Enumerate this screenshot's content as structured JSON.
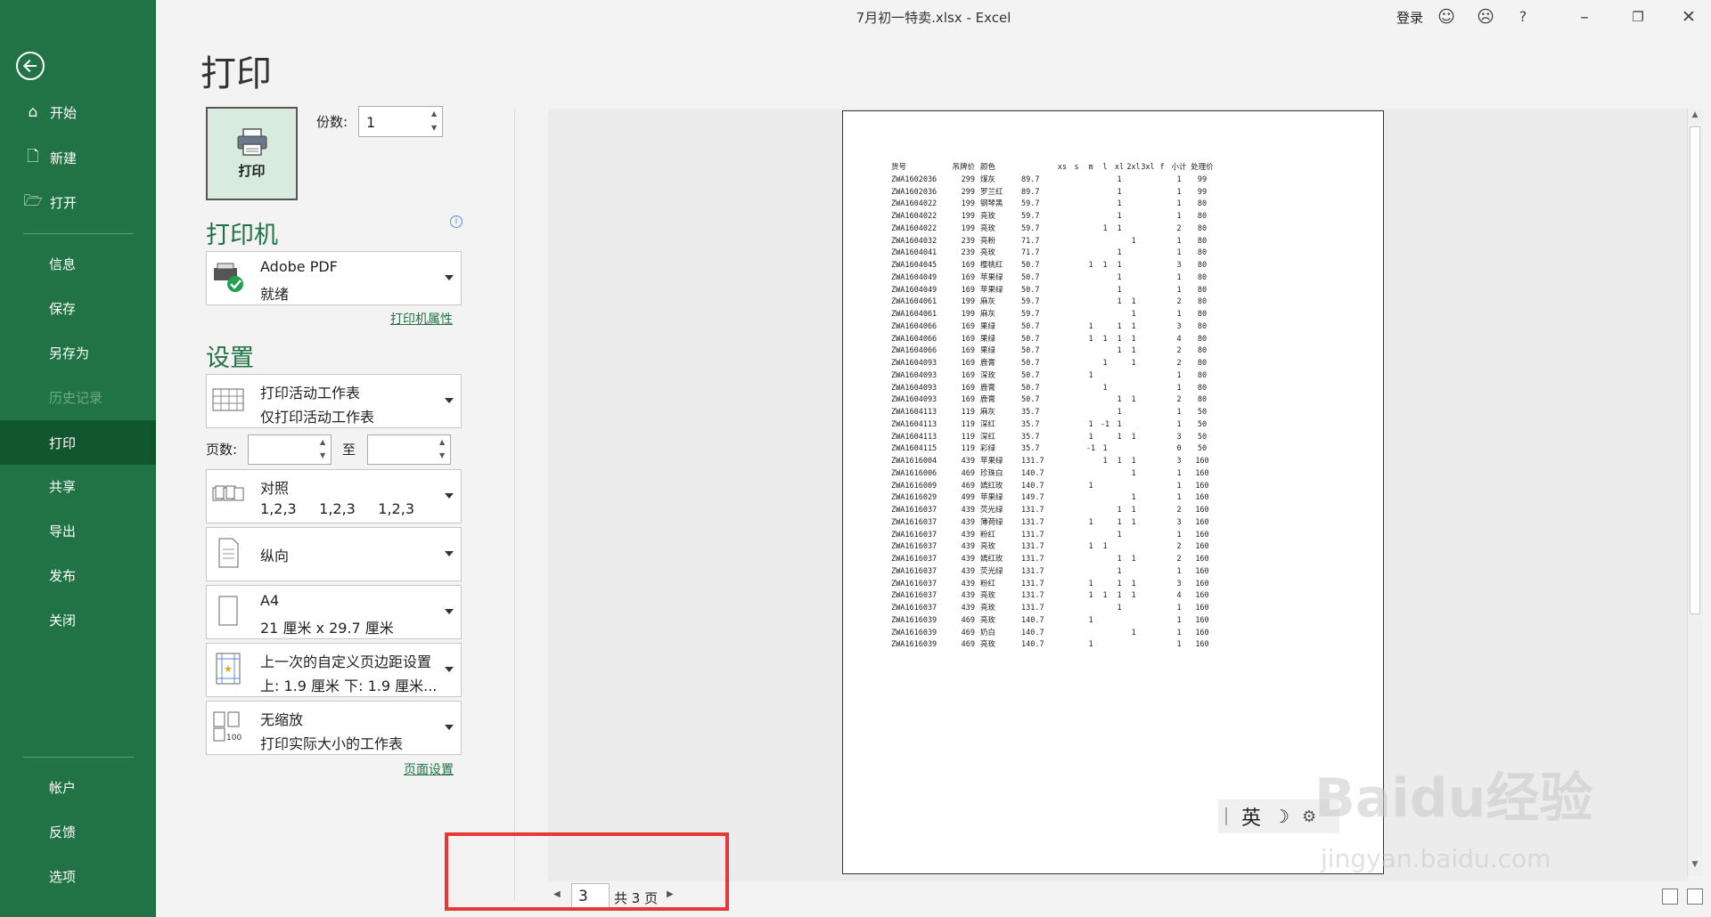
{
  "window": {
    "title": "7月初一特卖.xlsx  -  Excel",
    "signin": "登录"
  },
  "sidebar": {
    "top_items": [
      {
        "label": "开始",
        "icon": "home-icon"
      },
      {
        "label": "新建",
        "icon": "new-doc-icon"
      },
      {
        "label": "打开",
        "icon": "folder-open-icon"
      }
    ],
    "mid_items": [
      "信息",
      "保存",
      "另存为",
      "历史记录",
      "打印",
      "共享",
      "导出",
      "发布",
      "关闭"
    ],
    "active": "打印",
    "disabled": "历史记录",
    "bottom_items": [
      "帐户",
      "反馈",
      "选项"
    ]
  },
  "page_title": "打印",
  "print": {
    "button_label": "打印",
    "copies_label": "份数:",
    "copies_value": "1"
  },
  "printer": {
    "header": "打印机",
    "name": "Adobe PDF",
    "status": "就绪",
    "properties_link": "打印机属性"
  },
  "settings": {
    "header": "设置",
    "what": {
      "line1": "打印活动工作表",
      "line2": "仅打印活动工作表"
    },
    "pages_label": "页数:",
    "to_label": "至",
    "collate": {
      "line1": "对照",
      "line2": "1,2,3     1,2,3     1,2,3"
    },
    "orientation": "纵向",
    "paper": {
      "line1": "A4",
      "line2": "21 厘米 x 29.7 厘米"
    },
    "margins": {
      "line1": "上一次的自定义页边距设置",
      "line2": "上: 1.9 厘米 下: 1.9 厘米..."
    },
    "scaling": {
      "line1": "无缩放",
      "line2": "打印实际大小的工作表"
    },
    "page_setup_link": "页面设置"
  },
  "preview": {
    "headers": [
      "货号",
      "吊牌价",
      "颜色",
      "",
      "xs",
      "s",
      "m",
      "l",
      "xl",
      "2xl",
      "3xl",
      "f",
      "小计",
      "处理价"
    ],
    "rows": [
      [
        "ZWA1602036",
        "299",
        "煤灰",
        "89.7",
        "",
        "",
        "",
        "",
        "1",
        "",
        "",
        "",
        "1",
        "99"
      ],
      [
        "ZWA1602036",
        "299",
        "罗兰红",
        "89.7",
        "",
        "",
        "",
        "",
        "1",
        "",
        "",
        "",
        "1",
        "99"
      ],
      [
        "ZWA1604022",
        "199",
        "钢琴黑",
        "59.7",
        "",
        "",
        "",
        "",
        "1",
        "",
        "",
        "",
        "1",
        "80"
      ],
      [
        "ZWA1604022",
        "199",
        "亮玫",
        "59.7",
        "",
        "",
        "",
        "",
        "1",
        "",
        "",
        "",
        "1",
        "80"
      ],
      [
        "ZWA1604022",
        "199",
        "亮玫",
        "59.7",
        "",
        "",
        "",
        "1",
        "1",
        "",
        "",
        "",
        "2",
        "80"
      ],
      [
        "ZWA1604032",
        "239",
        "亮粉",
        "71.7",
        "",
        "",
        "",
        "",
        "",
        "1",
        "",
        "",
        "1",
        "80"
      ],
      [
        "ZWA1604041",
        "239",
        "亮玫",
        "71.7",
        "",
        "",
        "",
        "",
        "1",
        "",
        "",
        "",
        "1",
        "80"
      ],
      [
        "ZWA1604045",
        "169",
        "樱桃红",
        "50.7",
        "",
        "",
        "1",
        "1",
        "1",
        "",
        "",
        "",
        "3",
        "80"
      ],
      [
        "ZWA1604049",
        "169",
        "苹果绿",
        "50.7",
        "",
        "",
        "",
        "",
        "1",
        "",
        "",
        "",
        "1",
        "80"
      ],
      [
        "ZWA1604049",
        "169",
        "苹果绿",
        "50.7",
        "",
        "",
        "",
        "",
        "1",
        "",
        "",
        "",
        "1",
        "80"
      ],
      [
        "ZWA1604061",
        "199",
        "麻灰",
        "59.7",
        "",
        "",
        "",
        "",
        "1",
        "1",
        "",
        "",
        "2",
        "80"
      ],
      [
        "ZWA1604061",
        "199",
        "麻灰",
        "59.7",
        "",
        "",
        "",
        "",
        "",
        "1",
        "",
        "",
        "1",
        "80"
      ],
      [
        "ZWA1604066",
        "169",
        "果绿",
        "50.7",
        "",
        "",
        "1",
        "",
        "1",
        "1",
        "",
        "",
        "3",
        "80"
      ],
      [
        "ZWA1604066",
        "169",
        "果绿",
        "50.7",
        "",
        "",
        "1",
        "1",
        "1",
        "1",
        "",
        "",
        "4",
        "80"
      ],
      [
        "ZWA1604066",
        "169",
        "果绿",
        "50.7",
        "",
        "",
        "",
        "",
        "1",
        "1",
        "",
        "",
        "2",
        "80"
      ],
      [
        "ZWA1604093",
        "169",
        "鹿膏",
        "50.7",
        "",
        "",
        "",
        "1",
        "",
        "1",
        "",
        "",
        "2",
        "80"
      ],
      [
        "ZWA1604093",
        "169",
        "深玫",
        "50.7",
        "",
        "",
        "1",
        "",
        "",
        "",
        "",
        "",
        "1",
        "80"
      ],
      [
        "ZWA1604093",
        "169",
        "鹿膏",
        "50.7",
        "",
        "",
        "",
        "1",
        "",
        "",
        "",
        "",
        "1",
        "80"
      ],
      [
        "ZWA1604093",
        "169",
        "鹿膏",
        "50.7",
        "",
        "",
        "",
        "",
        "1",
        "1",
        "",
        "",
        "2",
        "80"
      ],
      [
        "ZWA1604113",
        "119",
        "麻灰",
        "35.7",
        "",
        "",
        "",
        "",
        "1",
        "",
        "",
        "",
        "1",
        "50"
      ],
      [
        "ZWA1604113",
        "119",
        "深红",
        "35.7",
        "",
        "",
        "1",
        "-1",
        "1",
        "",
        "",
        "",
        "1",
        "50"
      ],
      [
        "ZWA1604113",
        "119",
        "深红",
        "35.7",
        "",
        "",
        "1",
        "",
        "1",
        "1",
        "",
        "",
        "3",
        "50"
      ],
      [
        "ZWA1604115",
        "119",
        "彩绿",
        "35.7",
        "",
        "",
        "-1",
        "1",
        "",
        "",
        "",
        "",
        "0",
        "50"
      ],
      [
        "ZWA1616004",
        "439",
        "苹果绿",
        "131.7",
        "",
        "",
        "",
        "1",
        "1",
        "1",
        "",
        "",
        "3",
        "160"
      ],
      [
        "ZWA1616006",
        "469",
        "珍珠白",
        "140.7",
        "",
        "",
        "",
        "",
        "",
        "1",
        "",
        "",
        "1",
        "160"
      ],
      [
        "ZWA1616009",
        "469",
        "嫣红玫",
        "140.7",
        "",
        "",
        "1",
        "",
        "",
        "",
        "",
        "",
        "1",
        "160"
      ],
      [
        "ZWA1616029",
        "499",
        "苹果绿",
        "149.7",
        "",
        "",
        "",
        "",
        "",
        "1",
        "",
        "",
        "1",
        "160"
      ],
      [
        "ZWA1616037",
        "439",
        "荧光绿",
        "131.7",
        "",
        "",
        "",
        "",
        "1",
        "1",
        "",
        "",
        "2",
        "160"
      ],
      [
        "ZWA1616037",
        "439",
        "薄荷绿",
        "131.7",
        "",
        "",
        "1",
        "",
        "1",
        "1",
        "",
        "",
        "3",
        "160"
      ],
      [
        "ZWA1616037",
        "439",
        "粉红",
        "131.7",
        "",
        "",
        "",
        "",
        "1",
        "",
        "",
        "",
        "1",
        "160"
      ],
      [
        "ZWA1616037",
        "439",
        "亮玫",
        "131.7",
        "",
        "",
        "1",
        "1",
        "",
        "",
        "",
        "",
        "2",
        "160"
      ],
      [
        "ZWA1616037",
        "439",
        "嫣红玫",
        "131.7",
        "",
        "",
        "",
        "",
        "1",
        "1",
        "",
        "",
        "2",
        "160"
      ],
      [
        "ZWA1616037",
        "439",
        "荧光绿",
        "131.7",
        "",
        "",
        "",
        "",
        "1",
        "",
        "",
        "",
        "1",
        "160"
      ],
      [
        "ZWA1616037",
        "439",
        "粉红",
        "131.7",
        "",
        "",
        "1",
        "",
        "1",
        "1",
        "",
        "",
        "3",
        "160"
      ],
      [
        "ZWA1616037",
        "439",
        "亮玫",
        "131.7",
        "",
        "",
        "1",
        "1",
        "1",
        "1",
        "",
        "",
        "4",
        "160"
      ],
      [
        "ZWA1616037",
        "439",
        "亮玫",
        "131.7",
        "",
        "",
        "",
        "",
        "1",
        "",
        "",
        "",
        "1",
        "160"
      ],
      [
        "ZWA1616039",
        "469",
        "亮玫",
        "140.7",
        "",
        "",
        "1",
        "",
        "",
        "",
        "",
        "",
        "1",
        "160"
      ],
      [
        "ZWA1616039",
        "469",
        "奶白",
        "140.7",
        "",
        "",
        "",
        "",
        "",
        "1",
        "",
        "",
        "1",
        "160"
      ],
      [
        "ZWA1616039",
        "469",
        "亮玫",
        "140.7",
        "",
        "",
        "1",
        "",
        "",
        "",
        "",
        "",
        "1",
        "160"
      ]
    ]
  },
  "page_nav": {
    "current": "3",
    "total": "共 3 页"
  },
  "ime": {
    "lang": "英"
  },
  "watermark": {
    "logo": "Baidu经验",
    "url": "jingyan.baidu.com"
  },
  "colors": {
    "accent": "#217346",
    "accent_dark": "#10572f",
    "highlight": "#e53935"
  }
}
